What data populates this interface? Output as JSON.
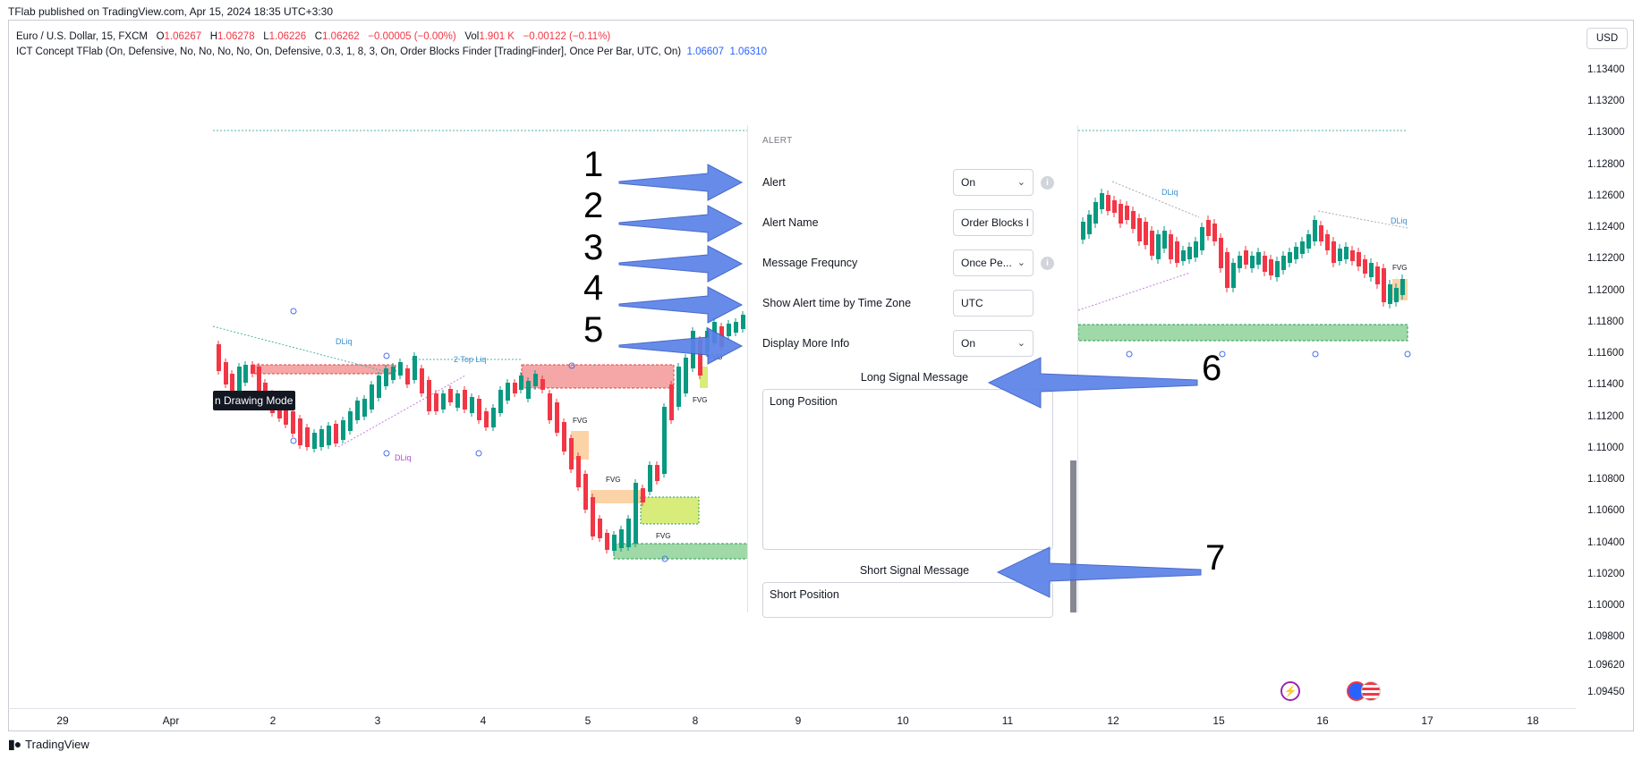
{
  "header": {
    "published": "TFlab published on TradingView.com, Apr 15, 2024 18:35 UTC+3:30"
  },
  "legend": {
    "symbol": "Euro / U.S. Dollar, 15, FXCM",
    "o_label": "O",
    "o_value": "1.06267",
    "h_label": "H",
    "h_value": "1.06278",
    "l_label": "L",
    "l_value": "1.06226",
    "c_label": "C",
    "c_value": "1.06262",
    "change": "−0.00005 (−0.00%)",
    "vol_label": "Vol",
    "vol_value": "1.901 K",
    "vol_change": "−0.00122 (−0.11%)",
    "indicator": "ICT Concept TFlab (On, Defensive, No, No, No, No, On, Defensive, 0.3, 1, 8, 3, On, Order Blocks Finder [TradingFinder], Once Per Bar, UTC, On)",
    "ind_value1": "1.06607",
    "ind_value2": "1.06310"
  },
  "currency_button": "USD",
  "price_axis": [
    "1.13400",
    "1.13200",
    "1.13000",
    "1.12800",
    "1.12600",
    "1.12400",
    "1.12200",
    "1.12000",
    "1.11800",
    "1.11600",
    "1.11400",
    "1.11200",
    "1.11000",
    "1.10800",
    "1.10600",
    "1.10400",
    "1.10200",
    "1.10000",
    "1.09800",
    "1.09620",
    "1.09450"
  ],
  "time_axis": [
    "29",
    "Apr",
    "2",
    "3",
    "4",
    "5",
    "8",
    "9",
    "10",
    "11",
    "12",
    "15",
    "16",
    "17",
    "18"
  ],
  "footer": {
    "brand": "TradingView"
  },
  "overlay_tip": "n Drawing Mode",
  "settings": {
    "section": "ALERT",
    "rows": [
      {
        "label": "Alert",
        "value": "On"
      },
      {
        "label": "Alert Name",
        "value": "Order Blocks I"
      },
      {
        "label": "Message Frequncy",
        "value": "Once Pe..."
      },
      {
        "label": "Show Alert time by Time Zone",
        "value": "UTC"
      },
      {
        "label": "Display More Info",
        "value": "On"
      }
    ],
    "long_title": "Long Signal Message",
    "long_value": "Long Position",
    "short_title": "Short Signal Message",
    "short_value": "Short Position"
  },
  "annotations": [
    "1",
    "2",
    "3",
    "4",
    "5",
    "6",
    "7"
  ],
  "chart_labels": {
    "dliq": "DLiq",
    "top_liq": "2 Top Liq",
    "fvg": "FVG"
  },
  "colors": {
    "bull": "#089981",
    "bear": "#f23645",
    "arrow_fill": "#5b82e8",
    "arrow_stroke": "#3a5fc8",
    "demand_zone": "#9fd9a8",
    "supply_zone": "#f5a7a7",
    "fvg_orange": "#fbd3a6",
    "fvg_yellow": "#d7ec7a"
  },
  "chart_data": {
    "type": "candlestick",
    "y_axis": {
      "range": [
        1.0945,
        1.1345
      ],
      "ticks": [
        "1.13400",
        "1.13200",
        "1.13000",
        "1.12800",
        "1.12600",
        "1.12400",
        "1.12200",
        "1.12000",
        "1.11800",
        "1.11600",
        "1.11400",
        "1.11200",
        "1.11000",
        "1.10800",
        "1.10600",
        "1.10400",
        "1.10200",
        "1.10000",
        "1.09800",
        "1.09620",
        "1.09450"
      ]
    },
    "x_axis": {
      "ticks": [
        "29",
        "Apr",
        "2",
        "3",
        "4",
        "5",
        "8",
        "9",
        "10",
        "11",
        "12",
        "15",
        "16",
        "17",
        "18"
      ]
    },
    "labels": [
      "DLiq",
      "2 Top Liq",
      "FVG"
    ]
  }
}
